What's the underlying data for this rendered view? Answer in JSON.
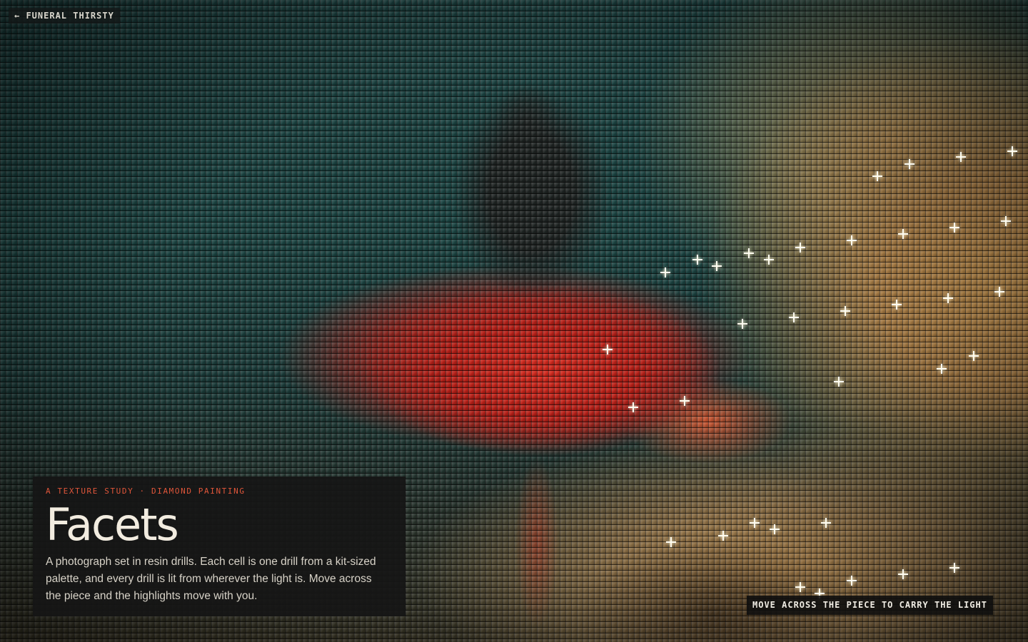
{
  "nav": {
    "back_label": "← FUNERAL THIRSTY"
  },
  "panel": {
    "eyebrow": "A TEXTURE STUDY · DIAMOND PAINTING",
    "title": "Facets",
    "description": "A photograph set in resin drills. Each cell is one drill from a kit-sized palette, and every drill is lit from wherever the light is. Move across the piece and the highlights move with you."
  },
  "hint": {
    "label": "MOVE ACROSS THE PIECE TO CARRY THE LIGHT"
  },
  "colors": {
    "accent": "#e0563a",
    "title_text": "#f2ece0",
    "panel_bg": "#161616",
    "teal_background": "#1b4442",
    "dress_red": "#d42a1e",
    "light_gold": "#c4924e",
    "sparkle": "#fffdf2"
  },
  "icons": {
    "back": "arrow-left-icon",
    "highlight": "sparkle-icon"
  }
}
